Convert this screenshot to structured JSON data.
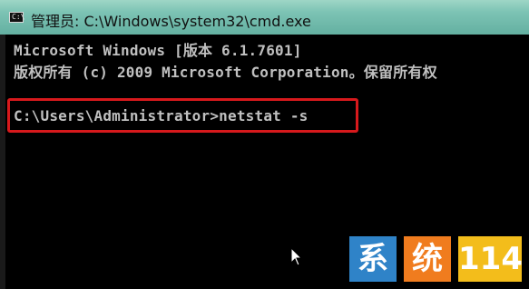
{
  "window": {
    "title": "管理员: C:\\Windows\\system32\\cmd.exe",
    "icon_label": "C:\\",
    "icon": "cmd-icon"
  },
  "console": {
    "lines": [
      "Microsoft Windows [版本 6.1.7601]",
      "版权所有 (c) 2009 Microsoft Corporation。保留所有权",
      "C:\\Users\\Administrator>netstat -s"
    ],
    "highlight_color": "#d7191c",
    "text_color": "#c0c0c0",
    "background": "#000000"
  },
  "cursor": {
    "icon": "mouse-pointer-icon"
  },
  "watermark": {
    "char1": "系",
    "char2": "统",
    "number": "114",
    "colors": [
      "#2f83c8",
      "#f07c1e",
      "#f3bd1b"
    ]
  }
}
